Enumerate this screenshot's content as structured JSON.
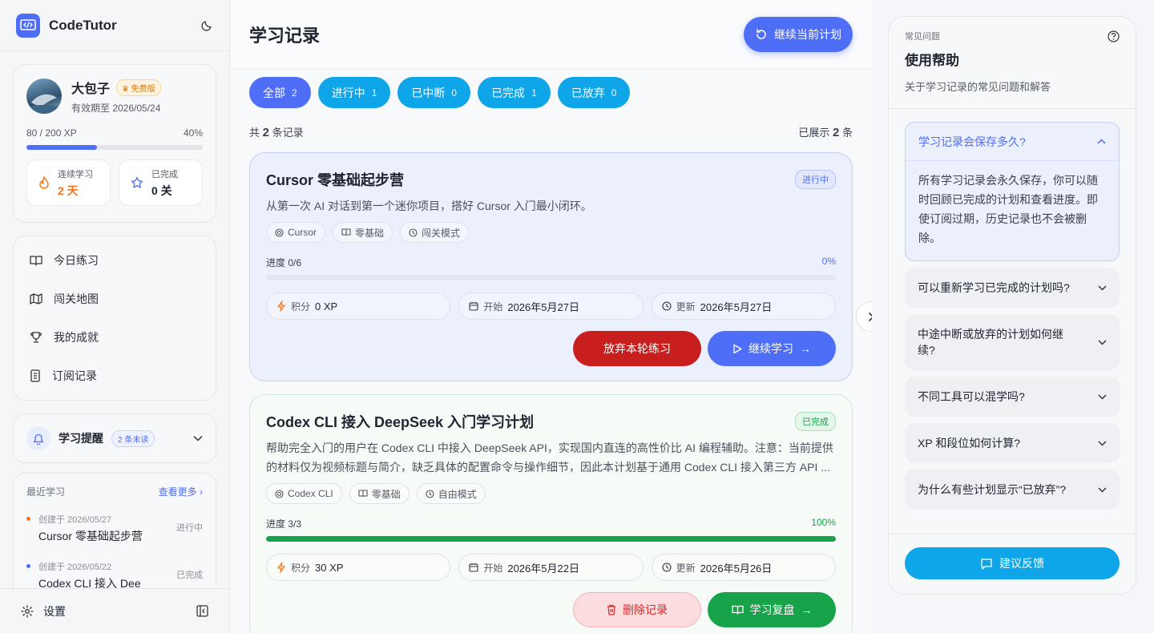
{
  "sidebar": {
    "brand": "CodeTutor",
    "user": {
      "name": "大包子",
      "plan_badge": "免费版",
      "expire": "有效期至 2026/05/24",
      "xp_text": "80 / 200 XP",
      "xp_percent": "40%",
      "xp_fraction": 0.4
    },
    "stats": [
      {
        "label": "连续学习",
        "value": "2 天",
        "icon": "flame-icon"
      },
      {
        "label": "已完成",
        "value": "0 关",
        "icon": "star-icon"
      }
    ],
    "nav": [
      {
        "label": "今日练习",
        "icon": "book-icon"
      },
      {
        "label": "闯关地图",
        "icon": "map-icon"
      },
      {
        "label": "我的成就",
        "icon": "trophy-icon"
      },
      {
        "label": "订阅记录",
        "icon": "document-icon"
      }
    ],
    "reminder": {
      "label": "学习提醒",
      "badge": "2 条未读"
    },
    "recent": {
      "title": "最近学习",
      "more": "查看更多",
      "items": [
        {
          "date": "创建于 2026/05/27",
          "title": "Cursor 零基础起步营",
          "status": "进行中",
          "color": "#f97316"
        },
        {
          "date": "创建于 2026/05/22",
          "title": "Codex CLI 接入 Dee",
          "status": "已完成",
          "color": "#4f6ef7"
        }
      ]
    },
    "settings": "设置"
  },
  "main": {
    "title": "学习记录",
    "continue_btn": "继续当前计划",
    "filters": [
      {
        "label": "全部",
        "count": "2"
      },
      {
        "label": "进行中",
        "count": "1"
      },
      {
        "label": "已中断",
        "count": "0"
      },
      {
        "label": "已完成",
        "count": "1"
      },
      {
        "label": "已放弃",
        "count": "0"
      }
    ],
    "total": {
      "pre": "共",
      "num": "2",
      "post": "条记录"
    },
    "shown": {
      "pre": "已展示",
      "num": "2",
      "post": "条"
    },
    "plans": [
      {
        "title": "Cursor 零基础起步营",
        "status": "进行中",
        "desc": "从第一次 AI 对话到第一个迷你项目，搭好 Cursor 入门最小闭环。",
        "tags": [
          "Cursor",
          "零基础",
          "闯关模式"
        ],
        "progress_label": "进度 0/6",
        "progress_pct": "0%",
        "progress": 0,
        "xp": {
          "label": "积分",
          "value": "0 XP"
        },
        "start": {
          "label": "开始",
          "value": "2026年5月27日"
        },
        "update": {
          "label": "更新",
          "value": "2026年5月27日"
        },
        "btn1": "放弃本轮练习",
        "btn2": "继续学习"
      },
      {
        "title": "Codex CLI 接入 DeepSeek 入门学习计划",
        "status": "已完成",
        "desc": "帮助完全入门的用户在 Codex CLI 中接入 DeepSeek API，实现国内直连的高性价比 AI 编程辅助。注意：当前提供的材料仅为视频标题与简介，缺乏具体的配置命令与操作细节，因此本计划基于通用 Codex CLI 接入第三方 API ...",
        "tags": [
          "Codex CLI",
          "零基础",
          "自由模式"
        ],
        "progress_label": "进度 3/3",
        "progress_pct": "100%",
        "progress": 1,
        "xp": {
          "label": "积分",
          "value": "30 XP"
        },
        "start": {
          "label": "开始",
          "value": "2026年5月22日"
        },
        "update": {
          "label": "更新",
          "value": "2026年5月26日"
        },
        "btn1": "删除记录",
        "btn2": "学习复盘"
      }
    ]
  },
  "help": {
    "sub": "常见问题",
    "title": "使用帮助",
    "desc": "关于学习记录的常见问题和解答",
    "open_q": "学习记录会保存多久?",
    "open_a": "所有学习记录会永久保存，你可以随时回顾已完成的计划和查看进度。即使订阅过期，历史记录也不会被删除。",
    "faqs": [
      "可以重新学习已完成的计划吗?",
      "中途中断或放弃的计划如何继续?",
      "不同工具可以混学吗?",
      "XP 和段位如何计算?",
      "为什么有些计划显示“已放弃”?"
    ],
    "feedback": "建议反馈"
  },
  "colors": {
    "accent": "#4f6ef7",
    "sky": "#0ea5e9",
    "success": "#16a34a",
    "danger": "#c81e1e"
  }
}
